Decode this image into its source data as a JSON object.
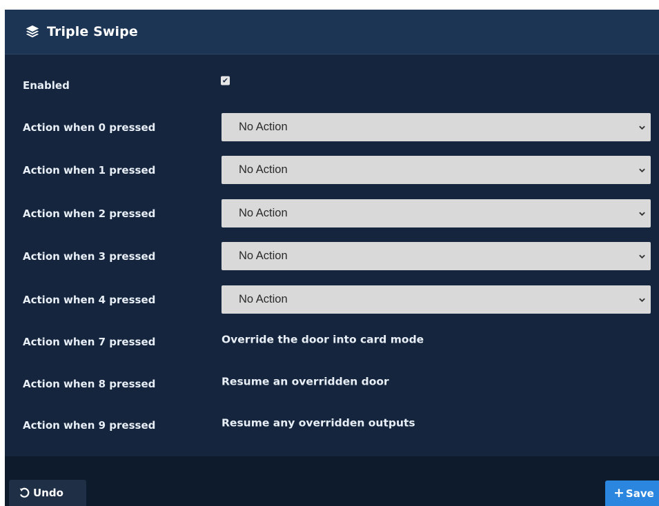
{
  "panel": {
    "title": "Triple Swipe",
    "title_icon": "layers-icon"
  },
  "form": {
    "enabled_label": "Enabled",
    "enabled_checked": true,
    "select_rows": [
      {
        "label": "Action when 0 pressed",
        "value": "No Action"
      },
      {
        "label": "Action when 1 pressed",
        "value": "No Action"
      },
      {
        "label": "Action when 2 pressed",
        "value": "No Action"
      },
      {
        "label": "Action when 3 pressed",
        "value": "No Action"
      },
      {
        "label": "Action when 4 pressed",
        "value": "No Action"
      }
    ],
    "static_rows": [
      {
        "label": "Action when 7 pressed",
        "value": "Override the door into card mode"
      },
      {
        "label": "Action when 8 pressed",
        "value": "Resume an overridden door"
      },
      {
        "label": "Action when 9 pressed",
        "value": "Resume any overridden outputs"
      }
    ]
  },
  "footer": {
    "undo_label": "Undo",
    "save_label": "Save"
  },
  "colors": {
    "panel_bg": "#14253d",
    "header_bg": "#1c3554",
    "select_bg": "#d9d9d9",
    "save_bg": "#2b86e0"
  }
}
